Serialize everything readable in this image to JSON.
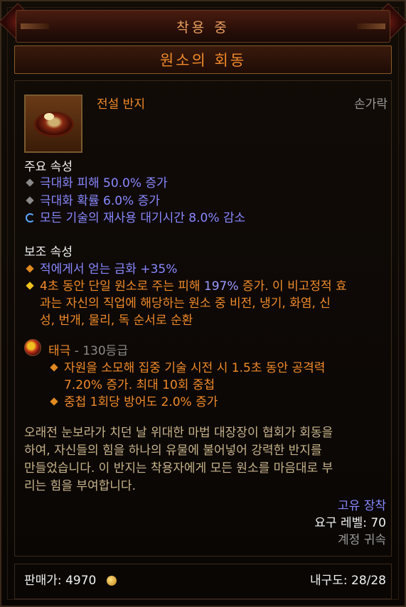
{
  "header": {
    "equipped_label": "착용 중",
    "item_name": "원소의 회동"
  },
  "item": {
    "type": "전설 반지",
    "slot": "손가락",
    "icon": "ring-icon"
  },
  "primary": {
    "title": "주요 속성",
    "stats": [
      {
        "text": "극대화 피해 50.0% 증가",
        "icon": "grey-diamond-bullet"
      },
      {
        "text": "극대화 확률 6.0% 증가",
        "icon": "grey-diamond-bullet"
      },
      {
        "text": "모든 기술의 재사용 대기시간 8.0% 감소",
        "icon": "enchant-swirl-icon"
      }
    ]
  },
  "secondary": {
    "title": "보조 속성",
    "stats": [
      {
        "text": "적에게서 얻는 금화 +35%",
        "icon": "orange-diamond-bullet"
      }
    ],
    "legendary": {
      "line1_a": "4초 동안 단일 원소로 주는 피해 ",
      "line1_num": "197%",
      "line1_b": " 증가. 이 비고정적 효",
      "line2": "과는 자신의 직업에 해당하는 원소 중 비전, 냉기, 화염, 신",
      "line3": "성, 번개, 물리, 독 순서로 순환"
    }
  },
  "legendary_gem": {
    "name": "태극",
    "rank": "- 130등급",
    "effect1_line1": "자원을 소모해 집중 기술 시전 시 1.5초 동안 공격력",
    "effect1_line2": "7.20% 증가. 최대 10회 중첩",
    "effect2": "중첩 1회당 방어도 2.0% 증가"
  },
  "flavor": {
    "lines": [
      "오래전 눈보라가 치던 날 위대한 마법 대장장이 협회가 회동을",
      "하여, 자신들의 힘을 하나의 유물에 불어넣어 강력한 반지를",
      "만들었습니다. 이 반지는 착용자에게 모든 원소를 마음대로 부",
      "리는 힘을 부여합니다."
    ]
  },
  "requirements": {
    "unique": "고유 장착",
    "level": "요구 레벨: 70",
    "bound": "계정 귀속"
  },
  "footer": {
    "price_label": "판매가:",
    "price_value": "4970",
    "durability": "내구도: 28/28"
  },
  "colors": {
    "legendary_orange": "#f08a2a",
    "magic_blue": "#8888ff",
    "flavor_tan": "#c8b48c"
  }
}
